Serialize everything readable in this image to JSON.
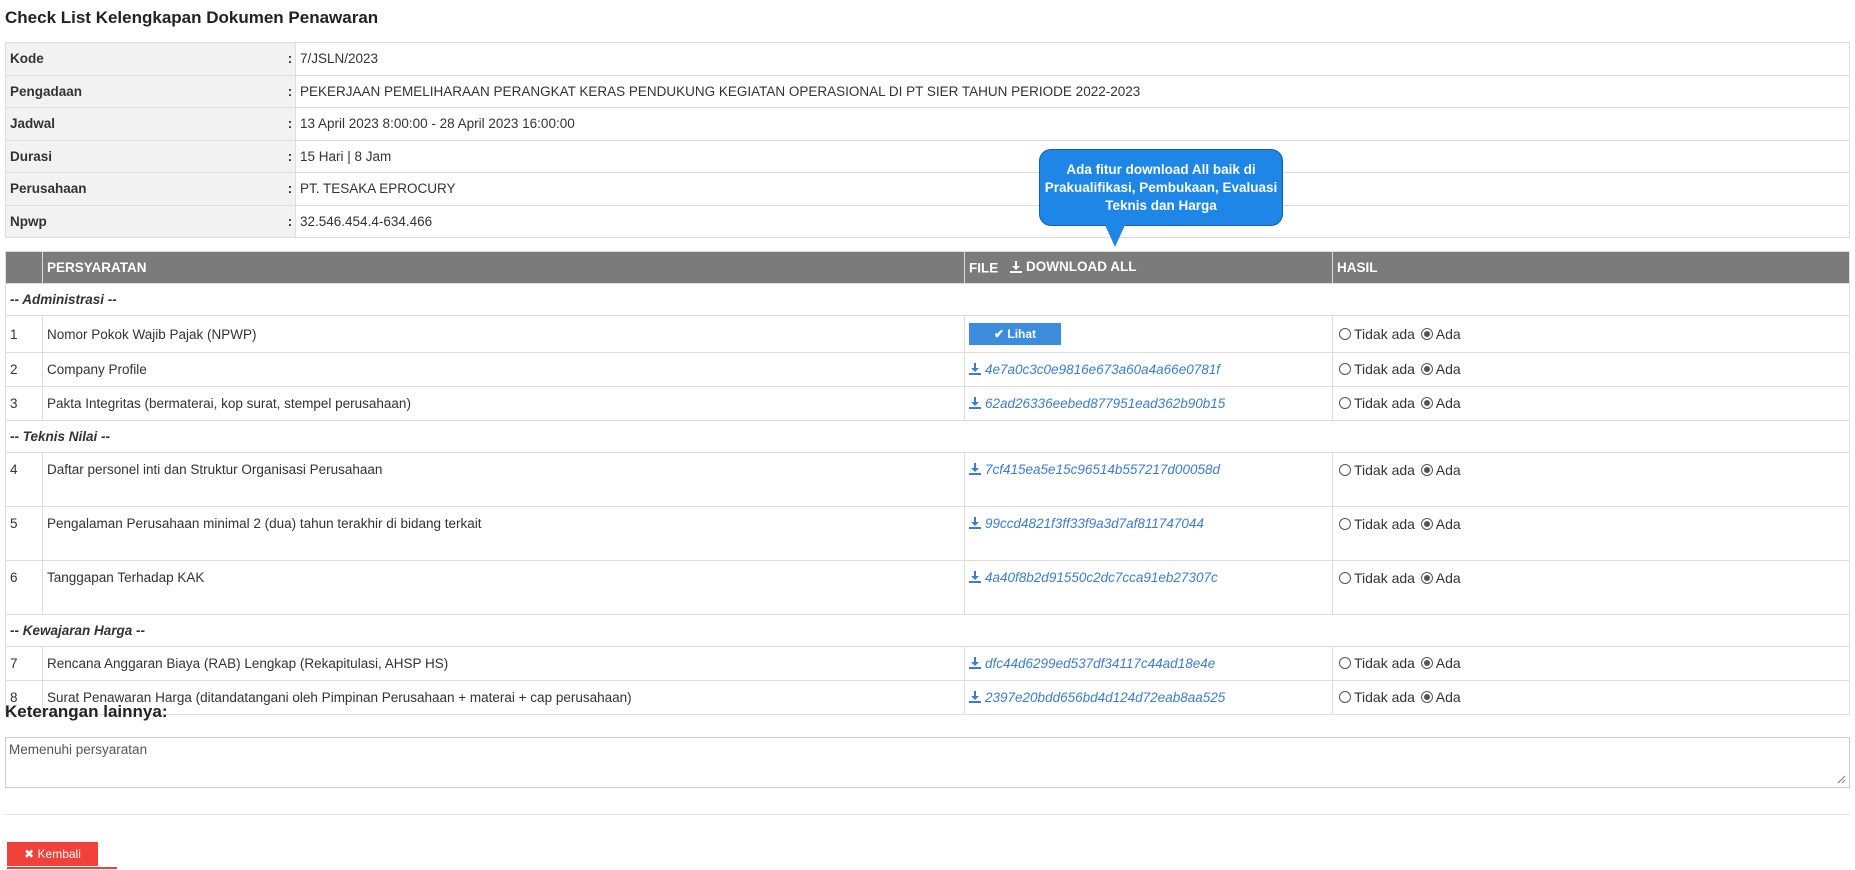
{
  "page": {
    "title": "Check List Kelengkapan Dokumen Penawaran"
  },
  "info": [
    {
      "label": "Kode",
      "sep": ":",
      "value": "7/JSLN/2023"
    },
    {
      "label": "Pengadaan",
      "sep": ":",
      "value": "PEKERJAAN PEMELIHARAAN PERANGKAT KERAS PENDUKUNG KEGIATAN OPERASIONAL DI PT SIER TAHUN PERIODE 2022-2023"
    },
    {
      "label": "Jadwal",
      "sep": ":",
      "value": "13 April 2023 8:00:00 - 28 April 2023 16:00:00"
    },
    {
      "label": "Durasi",
      "sep": ":",
      "value": "15 Hari | 8 Jam"
    },
    {
      "label": "Perusahaan",
      "sep": ":",
      "value": "PT. TESAKA EPROCURY"
    },
    {
      "label": "Npwp",
      "sep": ":",
      "value": "32.546.454.4-634.466"
    }
  ],
  "table": {
    "headers": {
      "requirement": "PERSYARATAN",
      "file": "FILE",
      "download_all": "DOWNLOAD ALL",
      "result": "HASIL"
    },
    "sections": [
      {
        "title": "-- Administrasi --"
      },
      {
        "title": "-- Teknis Nilai --"
      },
      {
        "title": "-- Kewajaran Harga --"
      }
    ],
    "rows": [
      {
        "no": "1",
        "name": "Nomor Pokok Wajib Pajak (NPWP)",
        "file": "Lihat"
      },
      {
        "no": "2",
        "name": "Company Profile",
        "file": "4e7a0c3c0e9816e673a60a4a66e0781f"
      },
      {
        "no": "3",
        "name": "Pakta Integritas (bermaterai, kop surat, stempel perusahaan)",
        "file": "62ad26336eebed877951ead362b90b15"
      },
      {
        "no": "4",
        "name": "Daftar personel inti dan Struktur Organisasi Perusahaan",
        "file": "7cf415ea5e15c96514b557217d00058d"
      },
      {
        "no": "5",
        "name": "Pengalaman Perusahaan minimal 2 (dua) tahun terakhir di bidang terkait",
        "file": "99ccd4821f3ff33f9a3d7af811747044"
      },
      {
        "no": "6",
        "name": "Tanggapan Terhadap KAK",
        "file": "4a40f8b2d91550c2dc7cca91eb27307c"
      },
      {
        "no": "7",
        "name": "Rencana Anggaran Biaya (RAB) Lengkap (Rekapitulasi, AHSP HS)",
        "file": "dfc44d6299ed537df34117c44ad18e4e"
      },
      {
        "no": "8",
        "name": "Surat Penawaran Harga (ditandatangani oleh Pimpinan Perusahaan + materai + cap perusahaan)",
        "file": "2397e20bdd656bd4d124d72eab8aa525"
      }
    ],
    "radio": {
      "no_label": "Tidak ada",
      "yes_label": "Ada",
      "selected": "Ada"
    }
  },
  "tooltip": {
    "text": "Ada fitur download All baik di Prakualifikasi, Pembukaan, Evaluasi Teknis dan Harga"
  },
  "notes": {
    "label": "Keterangan lainnya:",
    "value": "Memenuhi persyaratan"
  },
  "actions": {
    "back_label": "Kembali"
  },
  "colors": {
    "header_bg": "#7b7b7b",
    "link": "#3c7dd0",
    "primary": "#3c8dde",
    "danger": "#f0413a",
    "tooltip": "#1d86e6"
  }
}
